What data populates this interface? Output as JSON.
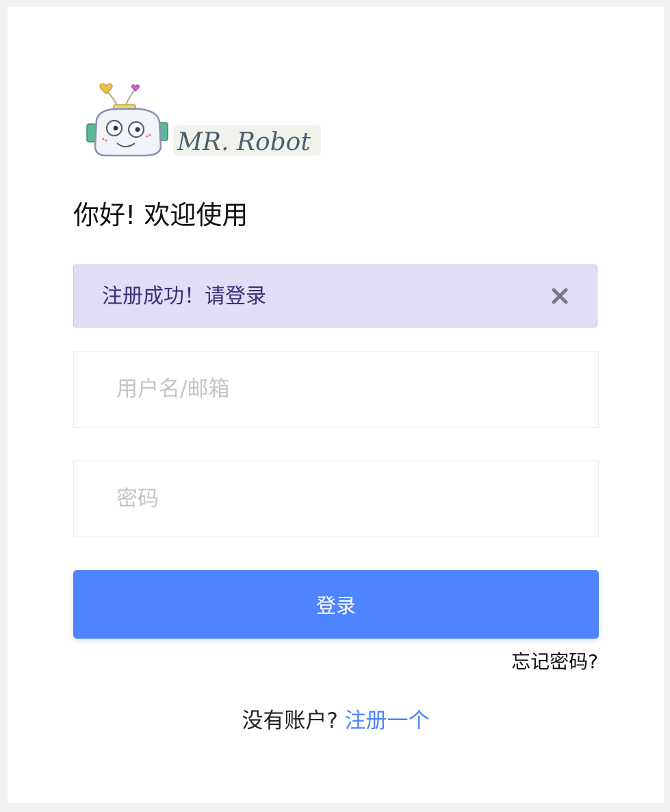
{
  "logo": {
    "text": "MR. Robot",
    "icon": "robot-head-icon"
  },
  "greeting": "你好! 欢迎使用",
  "alert": {
    "message": "注册成功！请登录",
    "close_icon": "close-icon",
    "background": "#e2dcf6",
    "text_color": "#3d2f78"
  },
  "form": {
    "username_placeholder": "用户名/邮箱",
    "username_value": "",
    "password_placeholder": "密码",
    "password_value": "",
    "login_label": "登录",
    "forgot_label": "忘记密码?"
  },
  "footer": {
    "question": "没有账户? ",
    "register_link": "注册一个"
  },
  "colors": {
    "primary": "#4f84ff",
    "page_background": "#f2f2f2"
  }
}
